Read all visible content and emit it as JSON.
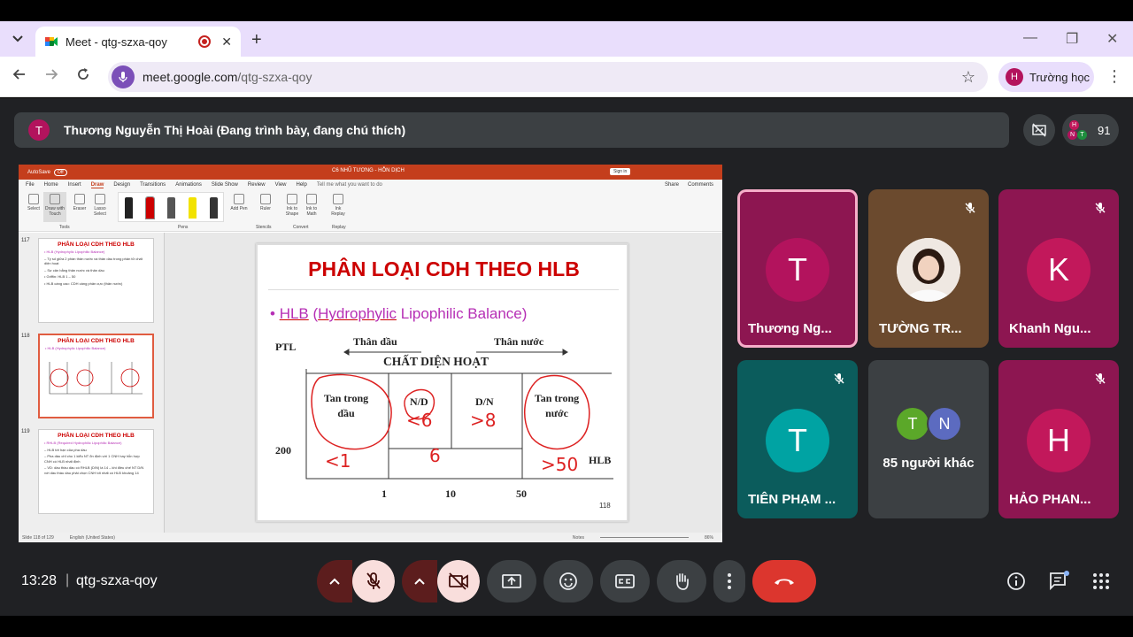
{
  "browser": {
    "tab_title": "Meet - qtg-szxa-qoy",
    "url_host": "meet.google.com",
    "url_path": "/qtg-szxa-qoy",
    "profile_initial": "H",
    "profile_label": "Trường học"
  },
  "meet": {
    "presenter_initial": "T",
    "presenter_text": "Thương Nguyễn Thị Hoài (Đang trình bày, đang chú thích)",
    "participant_count": "91",
    "time": "13:28",
    "separator": "|",
    "meeting_code": "qtg-szxa-qoy",
    "tiles": [
      {
        "initial": "T",
        "name": "Thương Ng...",
        "color": "#b3135d"
      },
      {
        "initial": "",
        "name": "TƯỜNG TR...",
        "color": "#6b4a2e"
      },
      {
        "initial": "K",
        "name": "Khanh Ngu...",
        "color": "#c2185b"
      },
      {
        "initial": "T",
        "name": "TIÊN PHẠM ...",
        "color": "#00a3a3"
      },
      {
        "initial": "",
        "name": "85 người khác",
        "color": "#3c4043"
      },
      {
        "initial": "H",
        "name": "HẢO PHAN...",
        "color": "#c2185b"
      }
    ],
    "others_avatars": [
      "T",
      "N"
    ]
  },
  "ppt": {
    "autosave": "AutoSave",
    "autosave_state": "Off",
    "doc_title": "C6 NHŨ TƯƠNG - HỖN DỊCH",
    "signin": "Sign in",
    "menu": [
      "File",
      "Home",
      "Insert",
      "Draw",
      "Design",
      "Transitions",
      "Animations",
      "Slide Show",
      "Review",
      "View",
      "Help"
    ],
    "tell_me": "Tell me what you want to do",
    "share": "Share",
    "comments": "Comments",
    "ribbon": {
      "select": "Select",
      "draw_touch": "Draw with Touch",
      "eraser": "Eraser",
      "lasso": "Lasso Select",
      "add_pen": "Add Pen",
      "ruler": "Ruler",
      "ink_shape": "Ink to Shape",
      "ink_math": "Ink to Math",
      "ink_replay": "Ink Replay",
      "grp_tools": "Tools",
      "grp_pens": "Pens",
      "grp_stencils": "Stencils",
      "grp_convert": "Convert",
      "grp_replay": "Replay"
    },
    "thumbs": [
      {
        "num": "117",
        "title": "PHÂN LOẠI CDH THEO HLB",
        "lines": [
          "• HLB (Hydrophylic Lipophilic Balance)",
          "– Tỷ số giữa 2 phần thân nước và thân dầu trong phân tử chất diện hoạt",
          "– Sự cân bằng thân nước và thân dầu",
          "• Griffin: HLB 1 – 50",
          "• HLB càng cao: CDH càng phân cực (thân nước)"
        ]
      },
      {
        "num": "118",
        "title": "PHÂN LOẠI CDH THEO HLB",
        "lines": [
          "• HLB (Hydrophylic Lipophilic Balance)"
        ]
      },
      {
        "num": "119",
        "title": "PHÂN LOẠI CDH THEO HLB",
        "lines": [
          "• RHLB (Required Hydrophilic Lipophilic Balance)",
          "– HLB tới hạn của pha dầu",
          "– Pha dầu chỉ cho 1 kiểu NT ổn định với 1 CNH hay hỗn hợp CNH có HLB nhất định",
          "– VD: dầu thầu dầu có RHLB (D/N) là 14 – khi điều chế NT D/N với dầu thầu dầu phải chọn CNH tốt nhất có HLB khoảng 14"
        ]
      }
    ],
    "slide": {
      "title": "PHÂN LOẠI CDH THEO HLB",
      "bullet_abbr": "HLB",
      "bullet_open": " (",
      "bullet_word1": "Hydrophylic",
      "bullet_rest": " Lipophilic Balance)",
      "ptl": "PTL",
      "than_dau": "Thân dầu",
      "than_nuoc": "Thân nước",
      "chat": "CHẤT DIỆN HOẠT",
      "tan_dau": "Tan trong dầu",
      "nd": "N/D",
      "dn": "D/N",
      "tan_nuoc": "Tan trong nước",
      "y200": "200",
      "hlb": "HLB",
      "x1": "1",
      "x10": "10",
      "x50": "50",
      "page": "118",
      "ink_lt1": "<1",
      "ink_lt6": "<6",
      "ink_gt8": ">8",
      "ink_6": "6",
      "ink_gt50": ">50"
    },
    "status": {
      "slide_of": "Slide 118 of 129",
      "lang": "English (United States)",
      "notes": "Notes",
      "zoom": "86%"
    }
  }
}
